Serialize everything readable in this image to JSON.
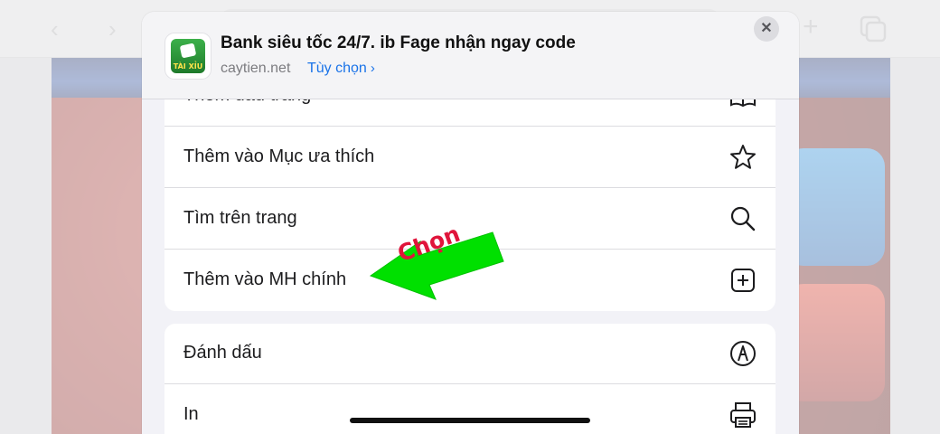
{
  "sheet": {
    "title": "Bank siêu tốc 24/7. ib Fage nhận ngay code",
    "domain": "caytien.net",
    "options_label": "Tùy chọn",
    "app_icon_text": "TÀI XỈU"
  },
  "group1": {
    "rows": [
      {
        "label": "Thêm dấu trang",
        "icon": "book-icon"
      },
      {
        "label": "Thêm vào Mục ưa thích",
        "icon": "star-icon"
      },
      {
        "label": "Tìm trên trang",
        "icon": "search-icon"
      },
      {
        "label": "Thêm vào MH chính",
        "icon": "plus-square-icon"
      }
    ]
  },
  "group2": {
    "rows": [
      {
        "label": "Đánh dấu",
        "icon": "markup-icon"
      },
      {
        "label": "In",
        "icon": "printer-icon"
      }
    ]
  },
  "annotation": {
    "text": "Chọn",
    "color": "#00e000",
    "text_color": "#e0153b"
  }
}
